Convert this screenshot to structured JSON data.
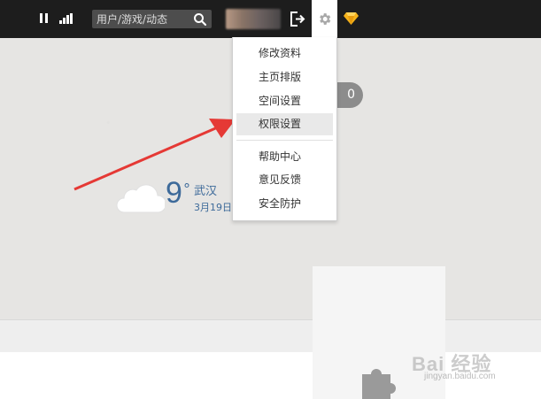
{
  "topbar": {
    "search_placeholder": "用户/游戏/动态",
    "icons": [
      "pause-icon",
      "signal-icon",
      "search-icon",
      "avatar",
      "logout-icon",
      "gear-icon",
      "diamond-icon"
    ]
  },
  "settings_menu": {
    "items": [
      {
        "label": "修改资料",
        "active": false
      },
      {
        "label": "主页排版",
        "active": false
      },
      {
        "label": "空间设置",
        "active": false
      },
      {
        "label": "权限设置",
        "active": true
      },
      {
        "label": "帮助中心",
        "active": false
      },
      {
        "label": "意见反馈",
        "active": false
      },
      {
        "label": "安全防护",
        "active": false
      }
    ]
  },
  "badge": {
    "count": "0"
  },
  "weather": {
    "temperature": "9",
    "degree_symbol": "°",
    "city": "武汉",
    "date": "3月19日"
  },
  "watermark": {
    "text": "Bai 经验",
    "sub": "jingyan.baidu.com"
  },
  "colors": {
    "topbar": "#1d1d1d",
    "accent_blue": "#3d6a9a",
    "arrow_red": "#e53935"
  }
}
